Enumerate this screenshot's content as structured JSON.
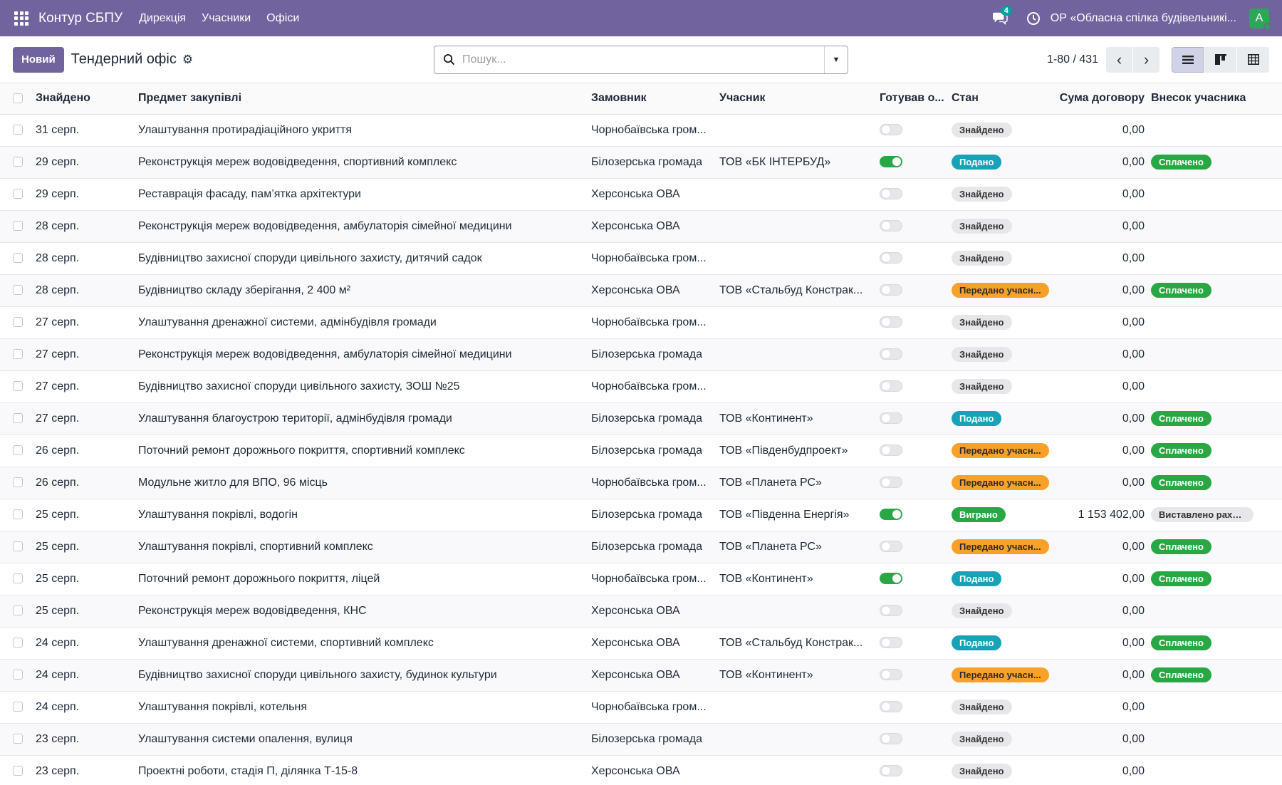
{
  "navbar": {
    "app_name": "Контур СБПУ",
    "menu": [
      "Дирекція",
      "Учасники",
      "Офіси"
    ],
    "chat_count": "4",
    "company": "ОР «Обласна спілка будівельникі...",
    "avatar_letter": "A"
  },
  "control": {
    "new_label": "Новий",
    "title": "Тендерний офіс",
    "search_placeholder": "Пошук...",
    "pager": "1-80 / 431"
  },
  "table": {
    "headers": {
      "found": "Знайдено",
      "subject": "Предмет закупівлі",
      "customer": "Замовник",
      "participant": "Учасник",
      "ready": "Готував о...",
      "state": "Стан",
      "sum": "Сума договору",
      "contribution": "Внесок учасника"
    },
    "rows": [
      {
        "date": "31 серп.",
        "subject": "Улаштування протирадіаційного укриття",
        "customer": "Чорнобаївська гром...",
        "participant": "",
        "ready": false,
        "state": "Знайдено",
        "state_color": "grey",
        "sum": "0,00",
        "contribution": "",
        "contribution_color": ""
      },
      {
        "date": "29 серп.",
        "subject": "Реконструкція мереж водовідведення, спортивний комплекс",
        "customer": "Білозерська громада",
        "participant": "ТОВ «БК ІНТЕРБУД»",
        "ready": true,
        "state": "Подано",
        "state_color": "blue",
        "sum": "0,00",
        "contribution": "Сплачено",
        "contribution_color": "green"
      },
      {
        "date": "29 серп.",
        "subject": "Реставрація фасаду, пам’ятка архітектури",
        "customer": "Херсонська ОВА",
        "participant": "",
        "ready": false,
        "state": "Знайдено",
        "state_color": "grey",
        "sum": "0,00",
        "contribution": "",
        "contribution_color": ""
      },
      {
        "date": "28 серп.",
        "subject": "Реконструкція мереж водовідведення, амбулаторія сімейної медицини",
        "customer": "Херсонська ОВА",
        "participant": "",
        "ready": false,
        "state": "Знайдено",
        "state_color": "grey",
        "sum": "0,00",
        "contribution": "",
        "contribution_color": ""
      },
      {
        "date": "28 серп.",
        "subject": "Будівництво захисної споруди цивільного захисту, дитячий садок",
        "customer": "Чорнобаївська гром...",
        "participant": "",
        "ready": false,
        "state": "Знайдено",
        "state_color": "grey",
        "sum": "0,00",
        "contribution": "",
        "contribution_color": ""
      },
      {
        "date": "28 серп.",
        "subject": "Будівництво складу зберігання, 2 400 м²",
        "customer": "Херсонська ОВА",
        "participant": "ТОВ «Стальбуд Констрак...",
        "ready": false,
        "state": "Передано учасн...",
        "state_color": "orange",
        "sum": "0,00",
        "contribution": "Сплачено",
        "contribution_color": "green"
      },
      {
        "date": "27 серп.",
        "subject": "Улаштування дренажної системи, адмінбудівля громади",
        "customer": "Чорнобаївська гром...",
        "participant": "",
        "ready": false,
        "state": "Знайдено",
        "state_color": "grey",
        "sum": "0,00",
        "contribution": "",
        "contribution_color": ""
      },
      {
        "date": "27 серп.",
        "subject": "Реконструкція мереж водовідведення, амбулаторія сімейної медицини",
        "customer": "Білозерська громада",
        "participant": "",
        "ready": false,
        "state": "Знайдено",
        "state_color": "grey",
        "sum": "0,00",
        "contribution": "",
        "contribution_color": ""
      },
      {
        "date": "27 серп.",
        "subject": "Будівництво захисної споруди цивільного захисту, ЗОШ №25",
        "customer": "Чорнобаївська гром...",
        "participant": "",
        "ready": false,
        "state": "Знайдено",
        "state_color": "grey",
        "sum": "0,00",
        "contribution": "",
        "contribution_color": ""
      },
      {
        "date": "27 серп.",
        "subject": "Улаштування благоустрою території, адмінбудівля громади",
        "customer": "Білозерська громада",
        "participant": "ТОВ «Континент»",
        "ready": false,
        "state": "Подано",
        "state_color": "blue",
        "sum": "0,00",
        "contribution": "Сплачено",
        "contribution_color": "green"
      },
      {
        "date": "26 серп.",
        "subject": "Поточний ремонт дорожнього покриття, спортивний комплекс",
        "customer": "Білозерська громада",
        "participant": "ТОВ «Південбудпроект»",
        "ready": false,
        "state": "Передано учасн...",
        "state_color": "orange",
        "sum": "0,00",
        "contribution": "Сплачено",
        "contribution_color": "green"
      },
      {
        "date": "26 серп.",
        "subject": "Модульне житло для ВПО, 96 місць",
        "customer": "Чорнобаївська гром...",
        "participant": "ТОВ «Планета РС»",
        "ready": false,
        "state": "Передано учасн...",
        "state_color": "orange",
        "sum": "0,00",
        "contribution": "Сплачено",
        "contribution_color": "green"
      },
      {
        "date": "25 серп.",
        "subject": "Улаштування покрівлі, водогін",
        "customer": "Білозерська громада",
        "participant": "ТОВ «Південна Енергія»",
        "ready": true,
        "state": "Виграно",
        "state_color": "green",
        "sum": "1 153 402,00",
        "contribution": "Виставлено рахунок",
        "contribution_color": "grey"
      },
      {
        "date": "25 серп.",
        "subject": "Улаштування покрівлі, спортивний комплекс",
        "customer": "Білозерська громада",
        "participant": "ТОВ «Планета РС»",
        "ready": false,
        "state": "Передано учасн...",
        "state_color": "orange",
        "sum": "0,00",
        "contribution": "Сплачено",
        "contribution_color": "green"
      },
      {
        "date": "25 серп.",
        "subject": "Поточний ремонт дорожнього покриття, ліцей",
        "customer": "Чорнобаївська гром...",
        "participant": "ТОВ «Континент»",
        "ready": true,
        "state": "Подано",
        "state_color": "blue",
        "sum": "0,00",
        "contribution": "Сплачено",
        "contribution_color": "green"
      },
      {
        "date": "25 серп.",
        "subject": "Реконструкція мереж водовідведення, КНС",
        "customer": "Херсонська ОВА",
        "participant": "",
        "ready": false,
        "state": "Знайдено",
        "state_color": "grey",
        "sum": "0,00",
        "contribution": "",
        "contribution_color": ""
      },
      {
        "date": "24 серп.",
        "subject": "Улаштування дренажної системи, спортивний комплекс",
        "customer": "Херсонська ОВА",
        "participant": "ТОВ «Стальбуд Констрак...",
        "ready": false,
        "state": "Подано",
        "state_color": "blue",
        "sum": "0,00",
        "contribution": "Сплачено",
        "contribution_color": "green"
      },
      {
        "date": "24 серп.",
        "subject": "Будівництво захисної споруди цивільного захисту, будинок культури",
        "customer": "Херсонська ОВА",
        "participant": "ТОВ «Континент»",
        "ready": false,
        "state": "Передано учасн...",
        "state_color": "orange",
        "sum": "0,00",
        "contribution": "Сплачено",
        "contribution_color": "green"
      },
      {
        "date": "24 серп.",
        "subject": "Улаштування покрівлі, котельня",
        "customer": "Чорнобаївська гром...",
        "participant": "",
        "ready": false,
        "state": "Знайдено",
        "state_color": "grey",
        "sum": "0,00",
        "contribution": "",
        "contribution_color": ""
      },
      {
        "date": "23 серп.",
        "subject": "Улаштування системи опалення, вулиця",
        "customer": "Білозерська громада",
        "participant": "",
        "ready": false,
        "state": "Знайдено",
        "state_color": "grey",
        "sum": "0,00",
        "contribution": "",
        "contribution_color": ""
      },
      {
        "date": "23 серп.",
        "subject": "Проектні роботи, стадія П, ділянка Т-15-8",
        "customer": "Херсонська ОВА",
        "participant": "",
        "ready": false,
        "state": "Знайдено",
        "state_color": "grey",
        "sum": "0,00",
        "contribution": "",
        "contribution_color": ""
      }
    ]
  }
}
